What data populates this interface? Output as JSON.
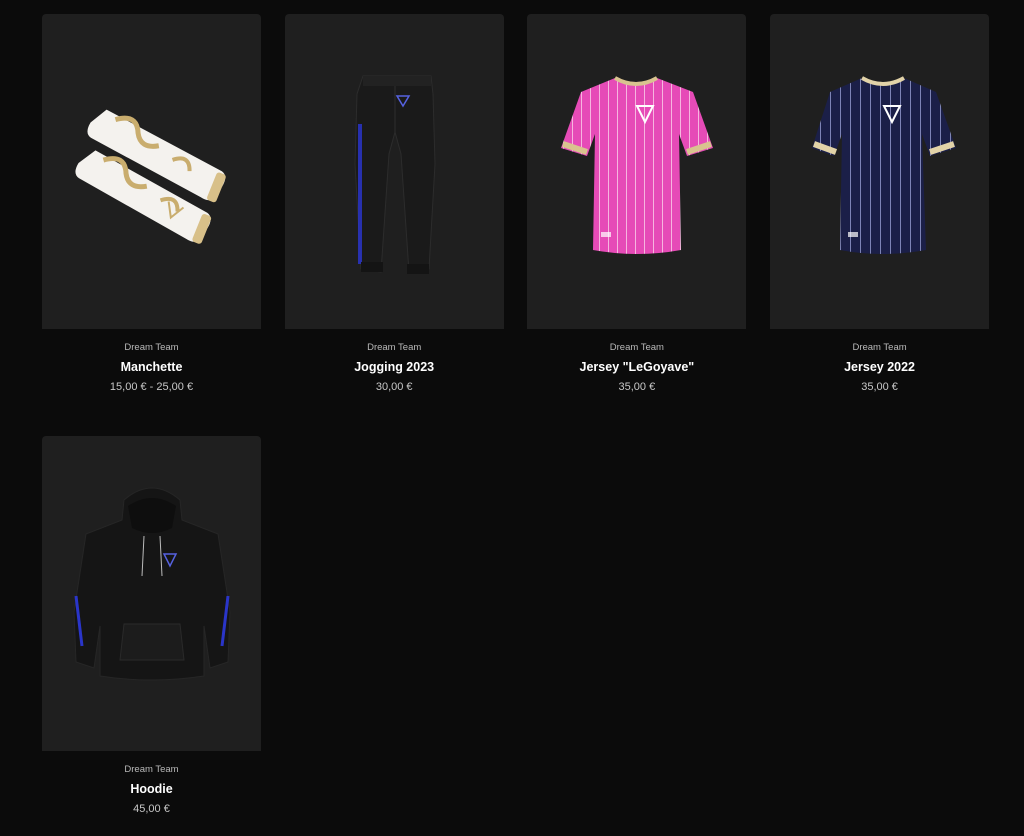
{
  "products": [
    {
      "brand": "Dream Team",
      "name": "Manchette",
      "price": "15,00 € - 25,00 €",
      "image": "arm-sleeves"
    },
    {
      "brand": "Dream Team",
      "name": "Jogging 2023",
      "price": "30,00 €",
      "image": "jogging-pants"
    },
    {
      "brand": "Dream Team",
      "name": "Jersey \"LeGoyave\"",
      "price": "35,00 €",
      "image": "pink-jersey"
    },
    {
      "brand": "Dream Team",
      "name": "Jersey 2022",
      "price": "35,00 €",
      "image": "navy-jersey"
    },
    {
      "brand": "Dream Team",
      "name": "Hoodie",
      "price": "45,00 €",
      "image": "black-hoodie"
    }
  ],
  "colors": {
    "background": "#0b0b0b",
    "card": "#1f1f1f",
    "pink": "#e64bb7",
    "navy": "#1b1f48",
    "gold": "#d9c38f",
    "accent_blue": "#2a35c9"
  }
}
